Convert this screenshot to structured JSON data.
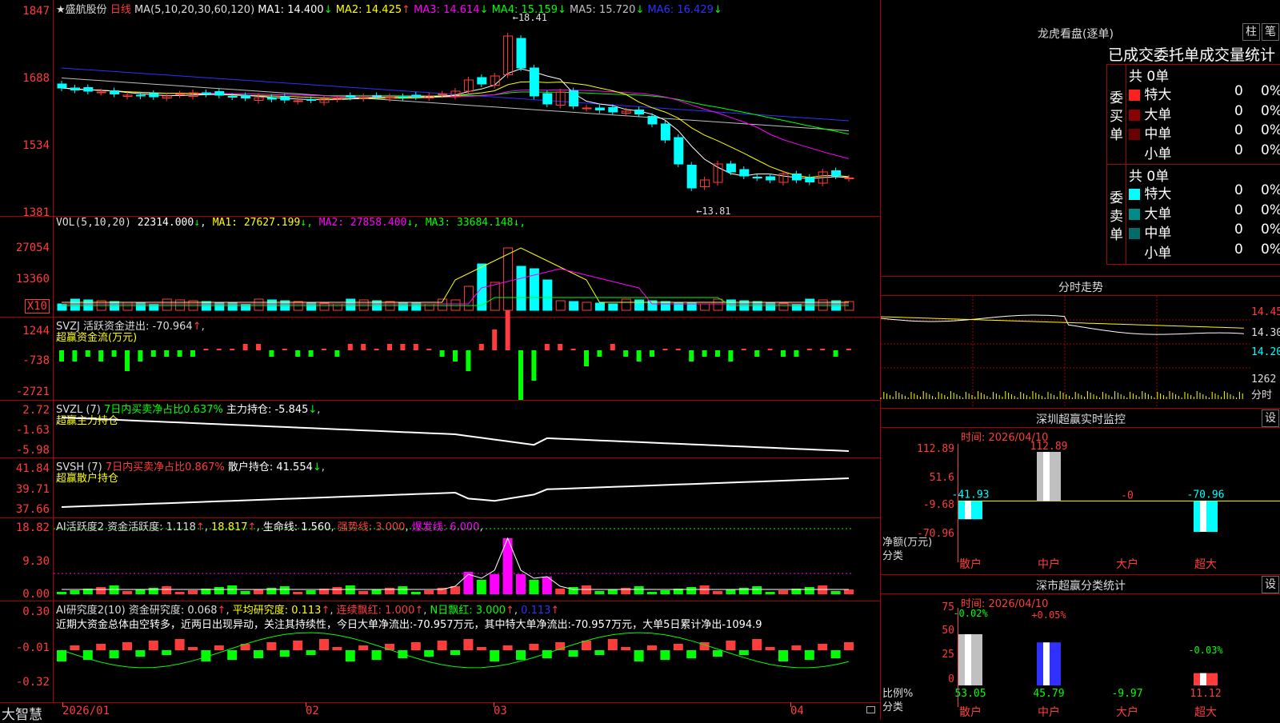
{
  "title_star": "★",
  "stock_name": "盛航股份",
  "period": "日线",
  "colors": {
    "red": "#ff3c3c",
    "cyan": "#00ffff",
    "yellow": "#ffff00",
    "magenta": "#ff00ff",
    "green": "#00ff00",
    "white": "#ffffff",
    "blue": "#3030ff",
    "gray": "#c0c0c0"
  },
  "main": {
    "ma_label": "MA(5,10,20,30,60,120)",
    "ma": [
      {
        "name": "MA1:",
        "value": "14.400",
        "arrow": "↓",
        "color": "#ffffff"
      },
      {
        "name": "MA2:",
        "value": "14.425",
        "arrow": "↑",
        "color": "#ffff00"
      },
      {
        "name": "MA3:",
        "value": "14.614",
        "arrow": "↓",
        "color": "#ff00ff"
      },
      {
        "name": "MA4:",
        "value": "15.159",
        "arrow": "↓",
        "color": "#00ff00"
      },
      {
        "name": "MA5:",
        "value": "15.720",
        "arrow": "↓",
        "color": "#c0c0c0"
      },
      {
        "name": "MA6:",
        "value": "16.429",
        "arrow": "↓",
        "color": "#3030ff"
      }
    ],
    "y_labels": [
      "1847",
      "1688",
      "1534",
      "1381"
    ],
    "high_mark": "18.41",
    "low_mark": "13.81"
  },
  "vol": {
    "label": "VOL(5,10,20)",
    "value": "22314.000",
    "value_arrow": "↓",
    "ma": [
      {
        "name": "MA1:",
        "value": "27627.199",
        "arrow": "↓",
        "color": "#ffff00"
      },
      {
        "name": "MA2:",
        "value": "27858.400",
        "arrow": "↓",
        "color": "#ff00ff"
      },
      {
        "name": "MA3:",
        "value": "33684.148",
        "arrow": "↓",
        "color": "#00ff00"
      }
    ],
    "y_labels": [
      "27054",
      "13360"
    ],
    "unit": "X10"
  },
  "svzj": {
    "line1": "SVZJ  活跃资金进出: -70.964",
    "line1_arrow": "↑",
    "line1_tail": ",",
    "line2": "超赢资金流(万元)",
    "y_labels": [
      "1244",
      "-738",
      "-2721"
    ]
  },
  "svzl": {
    "label": "SVZL (7)",
    "sub": "7日内买卖净占比0.637%",
    "hold_label": "主力持仓: -5.845",
    "arrow": "↓",
    "tail": ",",
    "line2": "超赢主力持仓",
    "y_labels": [
      "2.72",
      "-1.63",
      "-5.98"
    ]
  },
  "svsh": {
    "label": "SVSH (7)",
    "sub": "7日内买卖净占比0.867%",
    "hold_label": "散户持仓: 41.554",
    "arrow": "↓",
    "tail": ",",
    "line2": "超赢散户持仓",
    "y_labels": [
      "41.84",
      "39.71",
      "37.66"
    ]
  },
  "ai1": {
    "label": "AI活跃度2 资金活跃度: 1.118",
    "v2": "18.817",
    "v3": "生命线: 1.560",
    "v4": "强势线: 3.000",
    "v5": "爆发线: 6.000",
    "tail": ",",
    "y_labels": [
      "18.82",
      "9.30",
      "0.00"
    ]
  },
  "ai2": {
    "label": "AI研究度2(10) 资金研究度: 0.068",
    "v2": "平均研究度: 0.113",
    "v3": "连续飘红: 1.000",
    "v4": "N日飘红: 3.000",
    "v5": "0.113",
    "comment": "近期大资金总体由空转多，近两日出现异动，关注其持续性，今日大单净流出:-70.957万元，其中特大单净流出:-70.957万元，大单5日累计净出-1094.9",
    "y_labels": [
      "0.30",
      "-0.01",
      "-0.32"
    ]
  },
  "xaxis": {
    "brand": "大智慧",
    "labels": [
      "2026/01",
      "02",
      "03",
      "04"
    ]
  },
  "longhu": {
    "title": "龙虎看盘(逐单)",
    "btn1": "柱",
    "btn2": "笔",
    "subtitle": "已成交委托单成交量统计",
    "buy": {
      "side": "委买单",
      "total": "共 0单",
      "rows": [
        {
          "name": "特大",
          "count": "0",
          "pct": "0%",
          "color": "#ff2020"
        },
        {
          "name": "大单",
          "count": "0",
          "pct": "0%",
          "color": "#8b0000"
        },
        {
          "name": "中单",
          "count": "0",
          "pct": "0%",
          "color": "#6b0000"
        },
        {
          "name": "小单",
          "count": "0",
          "pct": "0%",
          "color": "#000000"
        }
      ]
    },
    "sell": {
      "side": "委卖单",
      "total": "共 0单",
      "rows": [
        {
          "name": "特大",
          "count": "0",
          "pct": "0%",
          "color": "#00ffff"
        },
        {
          "name": "大单",
          "count": "0",
          "pct": "0%",
          "color": "#008b8b"
        },
        {
          "name": "中单",
          "count": "0",
          "pct": "0%",
          "color": "#006b6b"
        },
        {
          "name": "小单",
          "count": "0",
          "pct": "0%",
          "color": "#000000"
        }
      ]
    }
  },
  "intraday": {
    "title": "分时走势",
    "y_labels": [
      "14.45",
      "14.30",
      "14.20"
    ],
    "vol_label": "1262",
    "vol_unit": "分时"
  },
  "sz_monitor": {
    "title": "深圳超赢实时监控",
    "btn": "设",
    "time": "时间: 2026/04/10",
    "y_labels": [
      "112.89",
      "51.6",
      "-9.68",
      "-70.96"
    ],
    "side_labels": [
      "净额(万元)",
      "分类"
    ],
    "cats": [
      "散户",
      "中户",
      "大户",
      "超大"
    ],
    "values": [
      -41.93,
      112.89,
      0,
      -70.96
    ],
    "value_labels": [
      "-41.93",
      "112.89",
      "-0",
      "-70.96"
    ]
  },
  "sz_class": {
    "title": "深市超赢分类统计",
    "btn": "设",
    "time": "时间: 2026/04/10",
    "y_labels": [
      "75",
      "50",
      "25",
      "0"
    ],
    "side_labels": [
      "比例%",
      "分类"
    ],
    "cats": [
      "散户",
      "中户",
      "大户",
      "超大"
    ],
    "ratios": [
      53.05,
      45.79,
      -9.97,
      11.12
    ],
    "ratio_labels": [
      "53.05",
      "45.79",
      "-9.97",
      "11.12"
    ],
    "changes": [
      "-0.02%",
      "+0.05%",
      "",
      "-0.03%"
    ]
  }
}
